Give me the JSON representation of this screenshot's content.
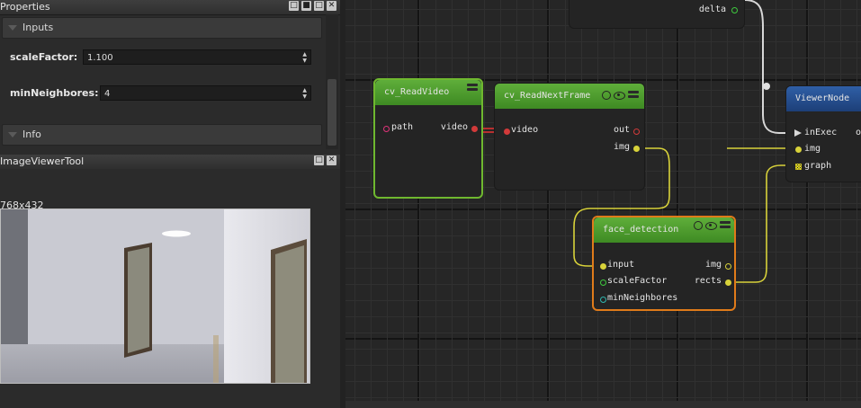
{
  "properties_panel": {
    "title": "Properties",
    "sections": [
      {
        "label": "Inputs"
      },
      {
        "label": "Info"
      }
    ],
    "fields": [
      {
        "label": "scaleFactor:",
        "value": "1.100"
      },
      {
        "label": "minNeighbores:",
        "value": "4"
      }
    ]
  },
  "viewer_panel": {
    "title": "ImageViewerTool",
    "dimensions": "768x432"
  },
  "graph": {
    "nodes": {
      "delta_node": {
        "port_delta": "delta"
      },
      "read_video": {
        "title": "cv_ReadVideo",
        "port_path": "path",
        "port_video": "video"
      },
      "read_next_frame": {
        "title": "cv_ReadNextFrame",
        "port_video": "video",
        "port_out": "out",
        "port_img": "img"
      },
      "face_detection": {
        "title": "face_detection",
        "port_input": "input",
        "port_scale": "scaleFactor",
        "port_min": "minNeighbores",
        "port_img": "img",
        "port_rects": "rects"
      },
      "viewer_node": {
        "title": "ViewerNode",
        "port_inexec": "inExec",
        "port_img": "img",
        "port_graph": "graph",
        "port_out_partial": "o"
      }
    }
  },
  "colors": {
    "node_green": "#4e9e2e",
    "selected_green": "#7cc23a",
    "selected_orange": "#e07b1a",
    "viewer_blue": "#2a5597",
    "wire_yellow": "#d8d23a",
    "wire_red": "#d23a3a",
    "wire_white": "#d8d8d8"
  }
}
